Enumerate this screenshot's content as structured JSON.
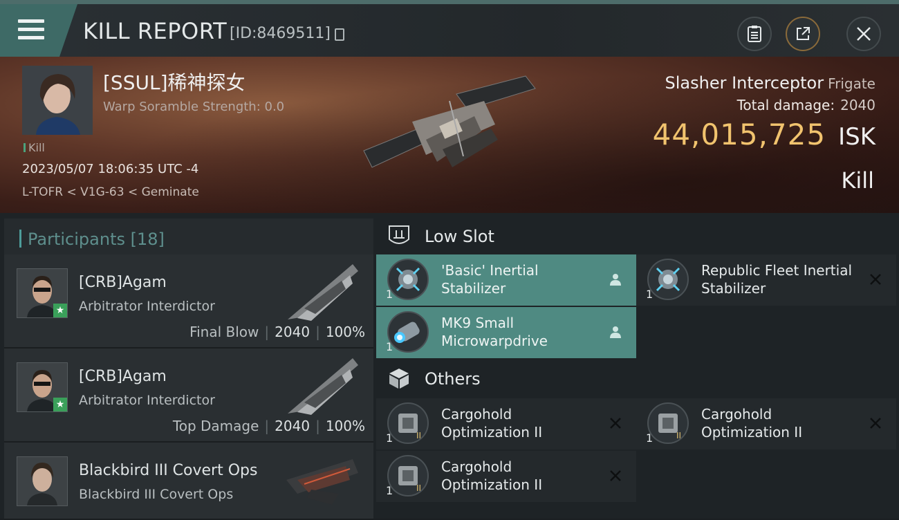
{
  "header": {
    "title": "KILL REPORT",
    "report_id": "[ID:8469511]"
  },
  "victim": {
    "name": "[SSUL]稀神探女",
    "scramble": "Warp Soramble Strength: 0.0",
    "kill_tag": "Kill",
    "datetime": "2023/05/07 18:06:35 UTC -4",
    "location": "L-TOFR < V1G-63 < Geminate"
  },
  "ship": {
    "name": "Slasher Interceptor",
    "class": "Frigate",
    "total_damage_label": "Total damage:",
    "total_damage": "2040",
    "isk_value": "44,015,725",
    "isk_label": "ISK",
    "kill_type": "Kill"
  },
  "participants": {
    "label": "Participants",
    "count": "[18]",
    "items": [
      {
        "name": "[CRB]Agam",
        "ship": "Arbitrator Interdictor",
        "role": "Final Blow",
        "damage": "2040",
        "percent": "100%"
      },
      {
        "name": "[CRB]Agam",
        "ship": "Arbitrator Interdictor",
        "role": "Top Damage",
        "damage": "2040",
        "percent": "100%"
      },
      {
        "name": "Blackbird III Covert Ops",
        "ship": "Blackbird III Covert Ops",
        "role": "",
        "damage": "",
        "percent": ""
      }
    ]
  },
  "low_slot": {
    "label": "Low Slot",
    "items": [
      {
        "name": "'Basic' Inertial Stabilizer",
        "qty": "1",
        "status": "fitted"
      },
      {
        "name": "Republic Fleet Inertial Stabilizer",
        "qty": "1",
        "status": "destroyed"
      },
      {
        "name": "MK9 Small Microwarpdrive",
        "qty": "1",
        "status": "fitted"
      }
    ]
  },
  "others": {
    "label": "Others",
    "items": [
      {
        "name": "Cargohold Optimization II",
        "qty": "1",
        "status": "destroyed"
      },
      {
        "name": "Cargohold Optimization II",
        "qty": "1",
        "status": "destroyed"
      },
      {
        "name": "Cargohold Optimization II",
        "qty": "1",
        "status": "destroyed"
      }
    ]
  },
  "colors": {
    "accent_teal": "#4f8a82",
    "isk_gold": "#f1c36e",
    "kill_green": "#4ba37c"
  }
}
